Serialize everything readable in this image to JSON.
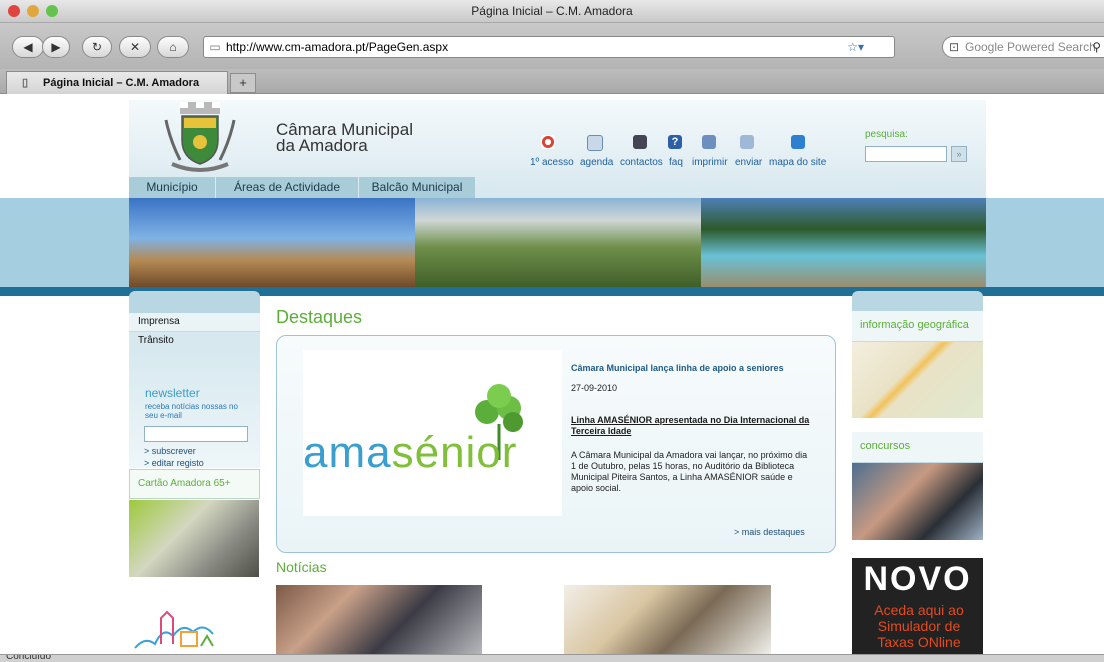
{
  "browser": {
    "window_title": "Página Inicial – C.M. Amadora",
    "url": "http://www.cm-amadora.pt/PageGen.aspx",
    "search_placeholder": "Google Powered Search",
    "tab_title": "Página Inicial – C.M. Amadora",
    "new_tab": "+",
    "status": "Concluído"
  },
  "header": {
    "title_line1": "Câmara Municipal",
    "title_line2": "da Amadora",
    "tools": [
      "1º acesso",
      "agenda",
      "contactos",
      "faq",
      "imprimir",
      "enviar",
      "mapa do site"
    ],
    "search_label": "pesquisa:"
  },
  "nav": [
    "Município",
    "Áreas de Actividade",
    "Balcão Municipal"
  ],
  "sidebar": {
    "links": [
      "Imprensa",
      "Trânsito"
    ],
    "newsletter_title": "newsletter",
    "newsletter_text": "receba notícias nossas no seu e-mail",
    "subscribe": "> subscrever",
    "edit": "> editar registo",
    "card": "Cartão Amadora 65+"
  },
  "destaques": {
    "heading": "Destaques",
    "logo_text_blue": "ama",
    "logo_text_green": "sénior",
    "headline": "Câmara Municipal lança linha de apoio a seniores",
    "date": "27-09-2010",
    "subtitle": "Linha AMASÉNIOR apresentada no Dia Internacional da Terceira Idade",
    "body": "A Câmara Municipal da Amadora vai lançar, no próximo dia 1 de Outubro, pelas 15 horas, no Auditório da Biblioteca Municipal Piteira Santos, a Linha AMASÉNIOR saúde e apoio social.",
    "more": "> mais destaques"
  },
  "noticias": {
    "heading": "Notícias"
  },
  "right": {
    "geo": "informação geográfica",
    "concursos": "concursos",
    "novo": "NOVO",
    "promo": "Aceda aqui ao Simulador de Taxas ONline"
  },
  "colors": {
    "green": "#5cae3a",
    "blue": "#1e4f7a",
    "stripe": "#1f6f96"
  }
}
